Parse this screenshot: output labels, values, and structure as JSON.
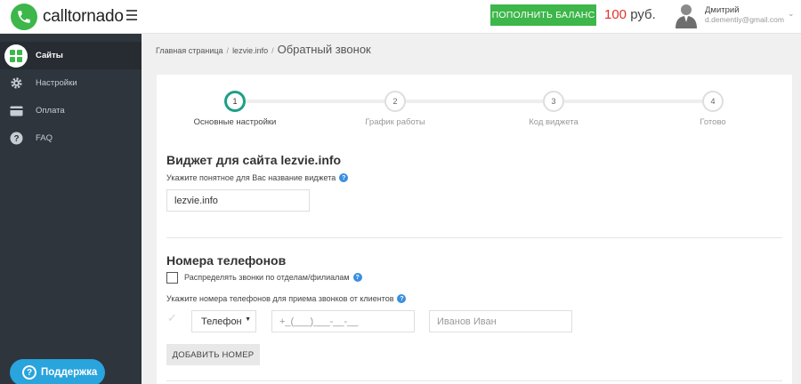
{
  "header": {
    "brand": "calltornado",
    "topup_label": "ПОПОЛНИТЬ БАЛАНС",
    "balance_amount": "100",
    "balance_currency": "руб.",
    "user_name": "Дмитрий",
    "user_email": "d.dementiy@gmail.com",
    "brand_color": "#3db64a"
  },
  "sidebar": {
    "items": [
      {
        "label": "Сайты",
        "icon": "sites-grid-icon",
        "active": true
      },
      {
        "label": "Настройки",
        "icon": "gear-icon"
      },
      {
        "label": "Оплата",
        "icon": "credit-card-icon"
      },
      {
        "label": "FAQ",
        "icon": "question-circle-icon"
      }
    ],
    "support_label": "Поддержка",
    "support_color": "#29a4dc"
  },
  "breadcrumb": {
    "home": "Главная страница",
    "site": "lezvie.info",
    "current": "Обратный звонок"
  },
  "stepper": {
    "active_color": "#1ca086",
    "steps": [
      {
        "number": "1",
        "label": "Основные настройки",
        "active": true
      },
      {
        "number": "2",
        "label": "График работы"
      },
      {
        "number": "3",
        "label": "Код виджета"
      },
      {
        "number": "4",
        "label": "Готово"
      }
    ]
  },
  "widget": {
    "title": "Виджет для сайта lezvie.info",
    "name_label": "Укажите понятное для Вас название виджета",
    "name_value": "lezvie.info"
  },
  "phones": {
    "title": "Номера телефонов",
    "distribute_label": "Распределять звонки по отделам/филиалам",
    "numbers_label": "Укажите номера телефонов для приема звонков от клиентов",
    "type_value": "Телефон",
    "number_placeholder": "+_(___)___-__-__",
    "name_placeholder": "Иванов Иван",
    "add_number_label": "ДОБАВИТЬ НОМЕР"
  }
}
